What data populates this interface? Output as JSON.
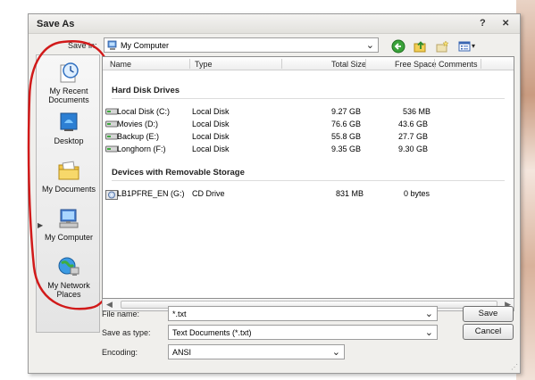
{
  "window": {
    "title": "Save As",
    "help_glyph": "?",
    "close_glyph": "✕"
  },
  "toolbar": {
    "save_in_label": "Save in:",
    "location": "My Computer",
    "views_glyph": "▾"
  },
  "places": [
    {
      "label": "My Recent Documents",
      "icon": "recent-documents-icon"
    },
    {
      "label": "Desktop",
      "icon": "desktop-icon"
    },
    {
      "label": "My Documents",
      "icon": "my-documents-icon"
    },
    {
      "label": "My Computer",
      "icon": "my-computer-icon"
    },
    {
      "label": "My Network Places",
      "icon": "network-places-icon"
    }
  ],
  "columns": [
    "Name",
    "Type",
    "Total Size",
    "Free Space",
    "Comments"
  ],
  "groups": {
    "hard_disks": {
      "title": "Hard Disk Drives",
      "rows": [
        {
          "name": "Local Disk (C:)",
          "type": "Local Disk",
          "total": "9.27 GB",
          "free": "536 MB"
        },
        {
          "name": "Movies (D:)",
          "type": "Local Disk",
          "total": "76.6 GB",
          "free": "43.6 GB"
        },
        {
          "name": "Backup (E:)",
          "type": "Local Disk",
          "total": "55.8 GB",
          "free": "27.7 GB"
        },
        {
          "name": "Longhorn (F:)",
          "type": "Local Disk",
          "total": "9.35 GB",
          "free": "9.30 GB"
        }
      ]
    },
    "removable": {
      "title": "Devices with Removable Storage",
      "rows": [
        {
          "name": "LB1PFRE_EN (G:)",
          "type": "CD Drive",
          "total": "831 MB",
          "free": "0 bytes"
        }
      ]
    }
  },
  "form": {
    "file_name_label": "File name:",
    "file_name_value": "*.txt",
    "save_type_label": "Save as type:",
    "save_type_value": "Text Documents (*.txt)",
    "encoding_label": "Encoding:",
    "encoding_value": "ANSI"
  },
  "buttons": {
    "save": "Save",
    "cancel": "Cancel"
  },
  "colors": {
    "annotation": "#d11a1a"
  }
}
